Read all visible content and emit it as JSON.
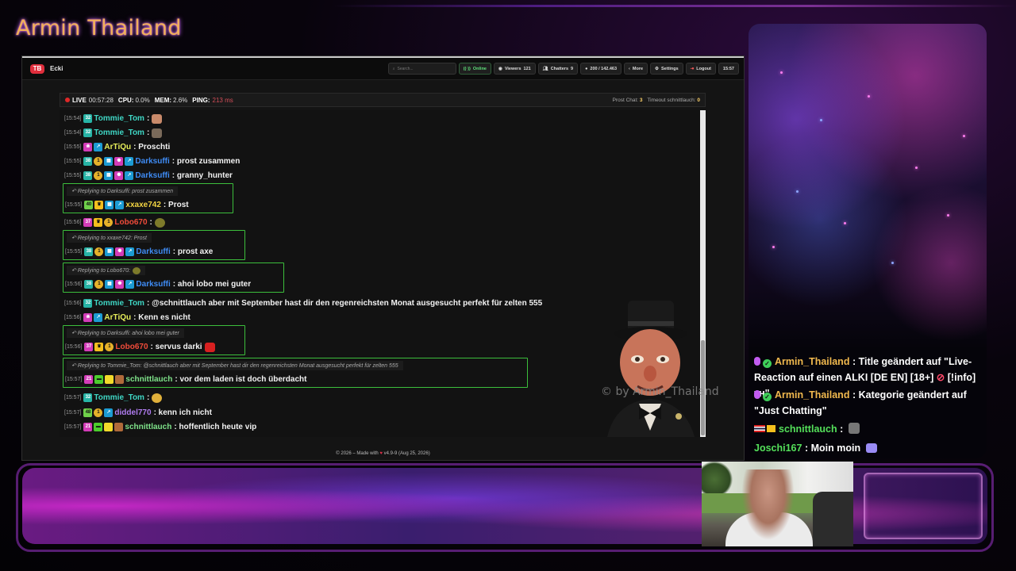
{
  "overlay": {
    "streamer_title": "Armin Thailand",
    "watermark": "© by Armin_Thailand"
  },
  "nav": {
    "logo": "TB",
    "channel": "Ecki",
    "search_placeholder": "Search...",
    "online": "Online",
    "viewers_label": "Viewers",
    "viewers_value": "121",
    "chatters_label": "Chatters",
    "chatters_value": "9",
    "messages": "200 / 142.463",
    "more": "More",
    "settings": "Settings",
    "logout": "Logout",
    "time": "15:57"
  },
  "status": {
    "live": "LIVE",
    "uptime": "00:57:28",
    "cpu_label": "CPU:",
    "cpu": "0.0%",
    "mem_label": "MEM:",
    "mem": "2.6%",
    "ping_label": "PING:",
    "ping": "213 ms",
    "prost_label": "Prost Chat:",
    "prost_value": "3",
    "timeout_label": "Timeout",
    "timeout_user": "schnittlauch:",
    "timeout_value": "0"
  },
  "chat": {
    "messages": [
      {
        "ts": "[15:54]",
        "user": "Tommie_Tom",
        "color": "#3fd7c5",
        "text": ""
      },
      {
        "ts": "[15:54]",
        "user": "Tommie_Tom",
        "color": "#3fd7c5",
        "text": ""
      },
      {
        "ts": "[15:55]",
        "user": "ArTiQu",
        "color": "#e7ee5a",
        "text": "Proschti"
      },
      {
        "ts": "[15:55]",
        "user": "Darksuffi",
        "color": "#3f8cf5",
        "text": "prost zusammen"
      },
      {
        "ts": "[15:55]",
        "user": "Darksuffi",
        "color": "#3f8cf5",
        "text": "granny_hunter"
      },
      {
        "ts": "[15:55]",
        "user": "xxaxe742",
        "color": "#f2d443",
        "text": "Prost",
        "reply": "Replying to Darksuffi: prost zusammen"
      },
      {
        "ts": "[15:56]",
        "user": "Lobo670",
        "color": "#f04b3a",
        "text": ""
      },
      {
        "ts": "[15:55]",
        "user": "Darksuffi",
        "color": "#3f8cf5",
        "text": "prost axe",
        "reply": "Replying to xxaxe742: Prost"
      },
      {
        "ts": "[15:56]",
        "user": "Darksuffi",
        "color": "#3f8cf5",
        "text": "ahoi lobo mei guter",
        "reply": "Replying to Lobo670:"
      },
      {
        "ts": "[15:56]",
        "user": "Tommie_Tom",
        "color": "#3fd7c5",
        "text": "@schnittlauch aber mit September hast dir den regenreichsten Monat ausgesucht perfekt für zelten 555"
      },
      {
        "ts": "[15:56]",
        "user": "ArTiQu",
        "color": "#e7ee5a",
        "text": "Kenn es nicht"
      },
      {
        "ts": "[15:56]",
        "user": "Lobo670",
        "color": "#f04b3a",
        "text": "servus darki",
        "reply": "Replying to Darksuffi: ahoi lobo mei guter"
      },
      {
        "ts": "[15:57]",
        "user": "schnittlauch",
        "color": "#7fe38a",
        "text": "vor dem laden ist doch überdacht",
        "reply": "Replying to Tommie_Tom: @schnittlauch aber mit September hast dir den regenreichsten Monat ausgesucht perfekt für zelten 555"
      },
      {
        "ts": "[15:57]",
        "user": "Tommie_Tom",
        "color": "#3fd7c5",
        "text": ""
      },
      {
        "ts": "[15:57]",
        "user": "diddel770",
        "color": "#b07cf0",
        "text": "kenn ich nicht"
      },
      {
        "ts": "[15:57]",
        "user": "schnittlauch",
        "color": "#7fe38a",
        "text": "hoffentlich heute vip"
      }
    ]
  },
  "footer": {
    "left": "© 2026 – Made with",
    "right": "v4.9-9 (Aug 25, 2026)"
  },
  "side_chat": [
    {
      "user": "Armin_Thailand",
      "text": ": Title geändert auf \"Live-Reaction auf einen ALKI [DE EN] [18+]",
      "tail": "[!info] ᴛʜ\""
    },
    {
      "user": "Armin_Thailand",
      "text": ": Kategorie geändert auf \"Just Chatting\""
    },
    {
      "user": "schnittlauch",
      "text": ":"
    },
    {
      "user": "Joschi167",
      "text": ": Moin moin"
    }
  ],
  "colors": {
    "accent_title": "#f0b15a",
    "reply_border": "#3cbe3c",
    "live_red": "#e02828",
    "panel_purple": "#7a2aa0"
  }
}
